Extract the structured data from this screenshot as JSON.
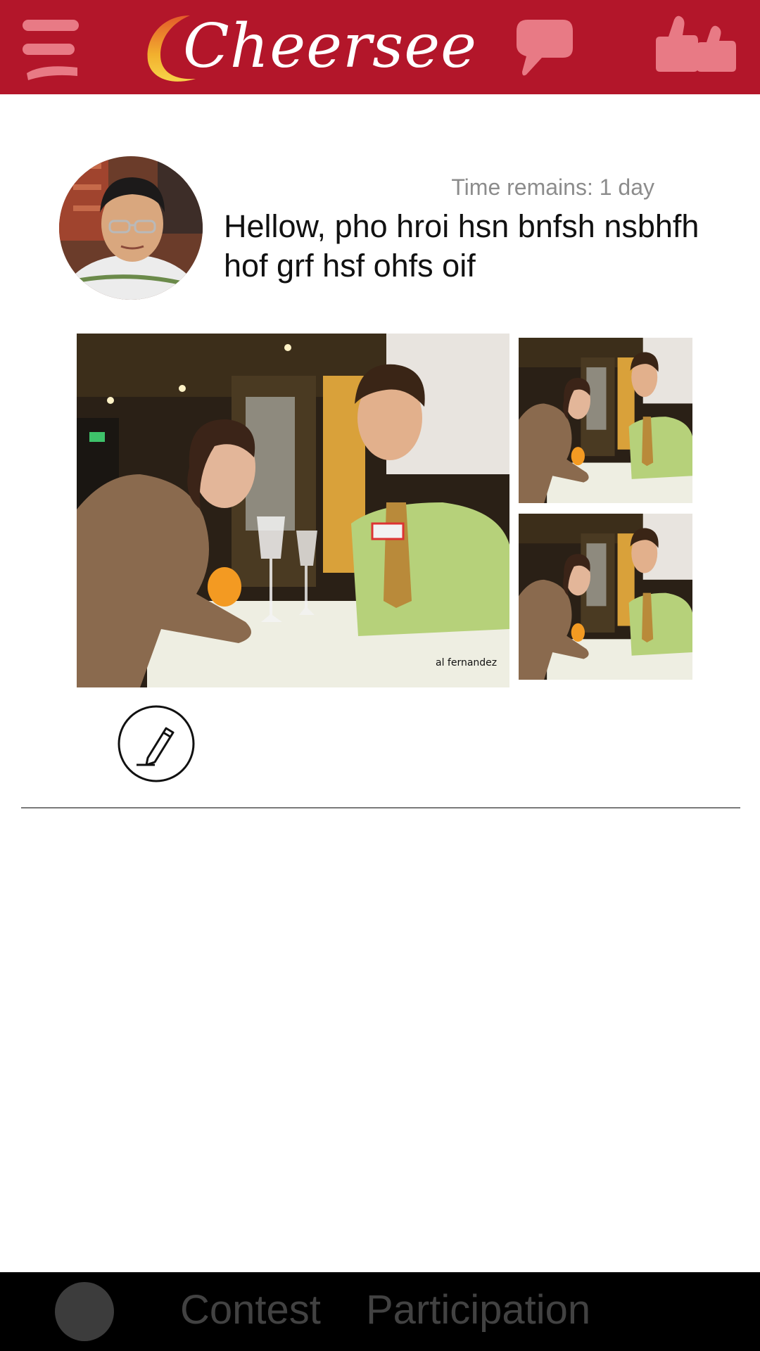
{
  "header": {
    "app_name": "Cheersee",
    "menu_icon": "hamburger-menu-icon",
    "chat_icon": "speech-bubble-icon",
    "likes_icon": "thumbs-up-icon",
    "background_color": "#b3162a"
  },
  "post": {
    "time_remaining": "Time remains: 1 day",
    "text": "Hellow, pho hroi hsn bnfsh nsbhfh hof grf hsf ohfs oif",
    "avatar": "user-avatar",
    "photos": [
      "restaurant-couple-photo",
      "restaurant-couple-photo",
      "restaurant-couple-photo"
    ],
    "photo_credit": "al fernandez",
    "edit_icon": "pencil-icon"
  },
  "bottom_nav": {
    "tabs": [
      {
        "label": "Contest"
      },
      {
        "label": "Participation"
      }
    ],
    "background_color": "#000000"
  }
}
